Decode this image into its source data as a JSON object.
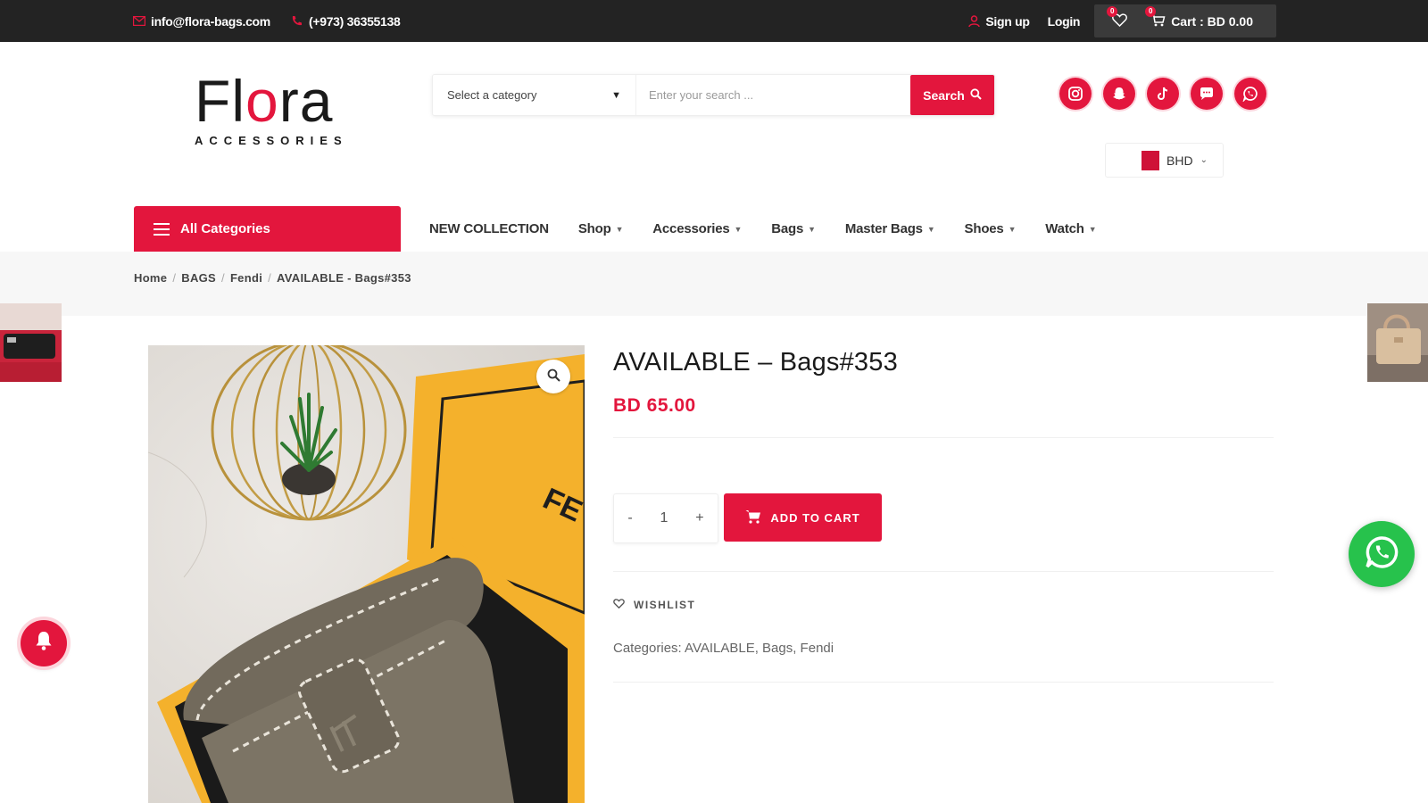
{
  "topbar": {
    "email": "info@flora-bags.com",
    "phone": "(+973) 36355138",
    "signup": "Sign up",
    "login": "Login",
    "wishlist_count": "0",
    "cart_count": "0",
    "cart_label": "Cart : BD 0.00"
  },
  "logo": {
    "word_f": "F",
    "word_l": "l",
    "word_o": "o",
    "word_rest": "ra",
    "sub": "ACCESSORIES"
  },
  "search": {
    "category_label": "Select a category",
    "placeholder": "Enter your search ...",
    "button_label": "Search"
  },
  "socials": [
    "instagram-icon",
    "snapchat-icon",
    "tiktok-icon",
    "message-icon",
    "whatsapp-icon"
  ],
  "currency": {
    "code": "BHD"
  },
  "nav": {
    "all_categories": "All Categories",
    "items": [
      {
        "label": "NEW COLLECTION",
        "has_caret": false
      },
      {
        "label": "Shop",
        "has_caret": true
      },
      {
        "label": "Accessories",
        "has_caret": true
      },
      {
        "label": "Bags",
        "has_caret": true
      },
      {
        "label": "Master Bags",
        "has_caret": true
      },
      {
        "label": "Shoes",
        "has_caret": true
      },
      {
        "label": "Watch",
        "has_caret": true
      }
    ]
  },
  "breadcrumb": [
    "Home",
    "BAGS",
    "Fendi",
    "AVAILABLE - Bags#353"
  ],
  "product": {
    "title": "AVAILABLE – Bags#353",
    "price": "BD 65.00",
    "quantity": "1",
    "qty_minus": "-",
    "qty_plus": "+",
    "add_to_cart": "ADD TO CART",
    "wishlist": "WISHLIST",
    "categories_text": "Categories: AVAILABLE, Bags, Fendi",
    "box_text": "FE"
  },
  "colors": {
    "accent": "#e3163d",
    "topbar": "#232323",
    "whatsapp": "#27c24c"
  }
}
